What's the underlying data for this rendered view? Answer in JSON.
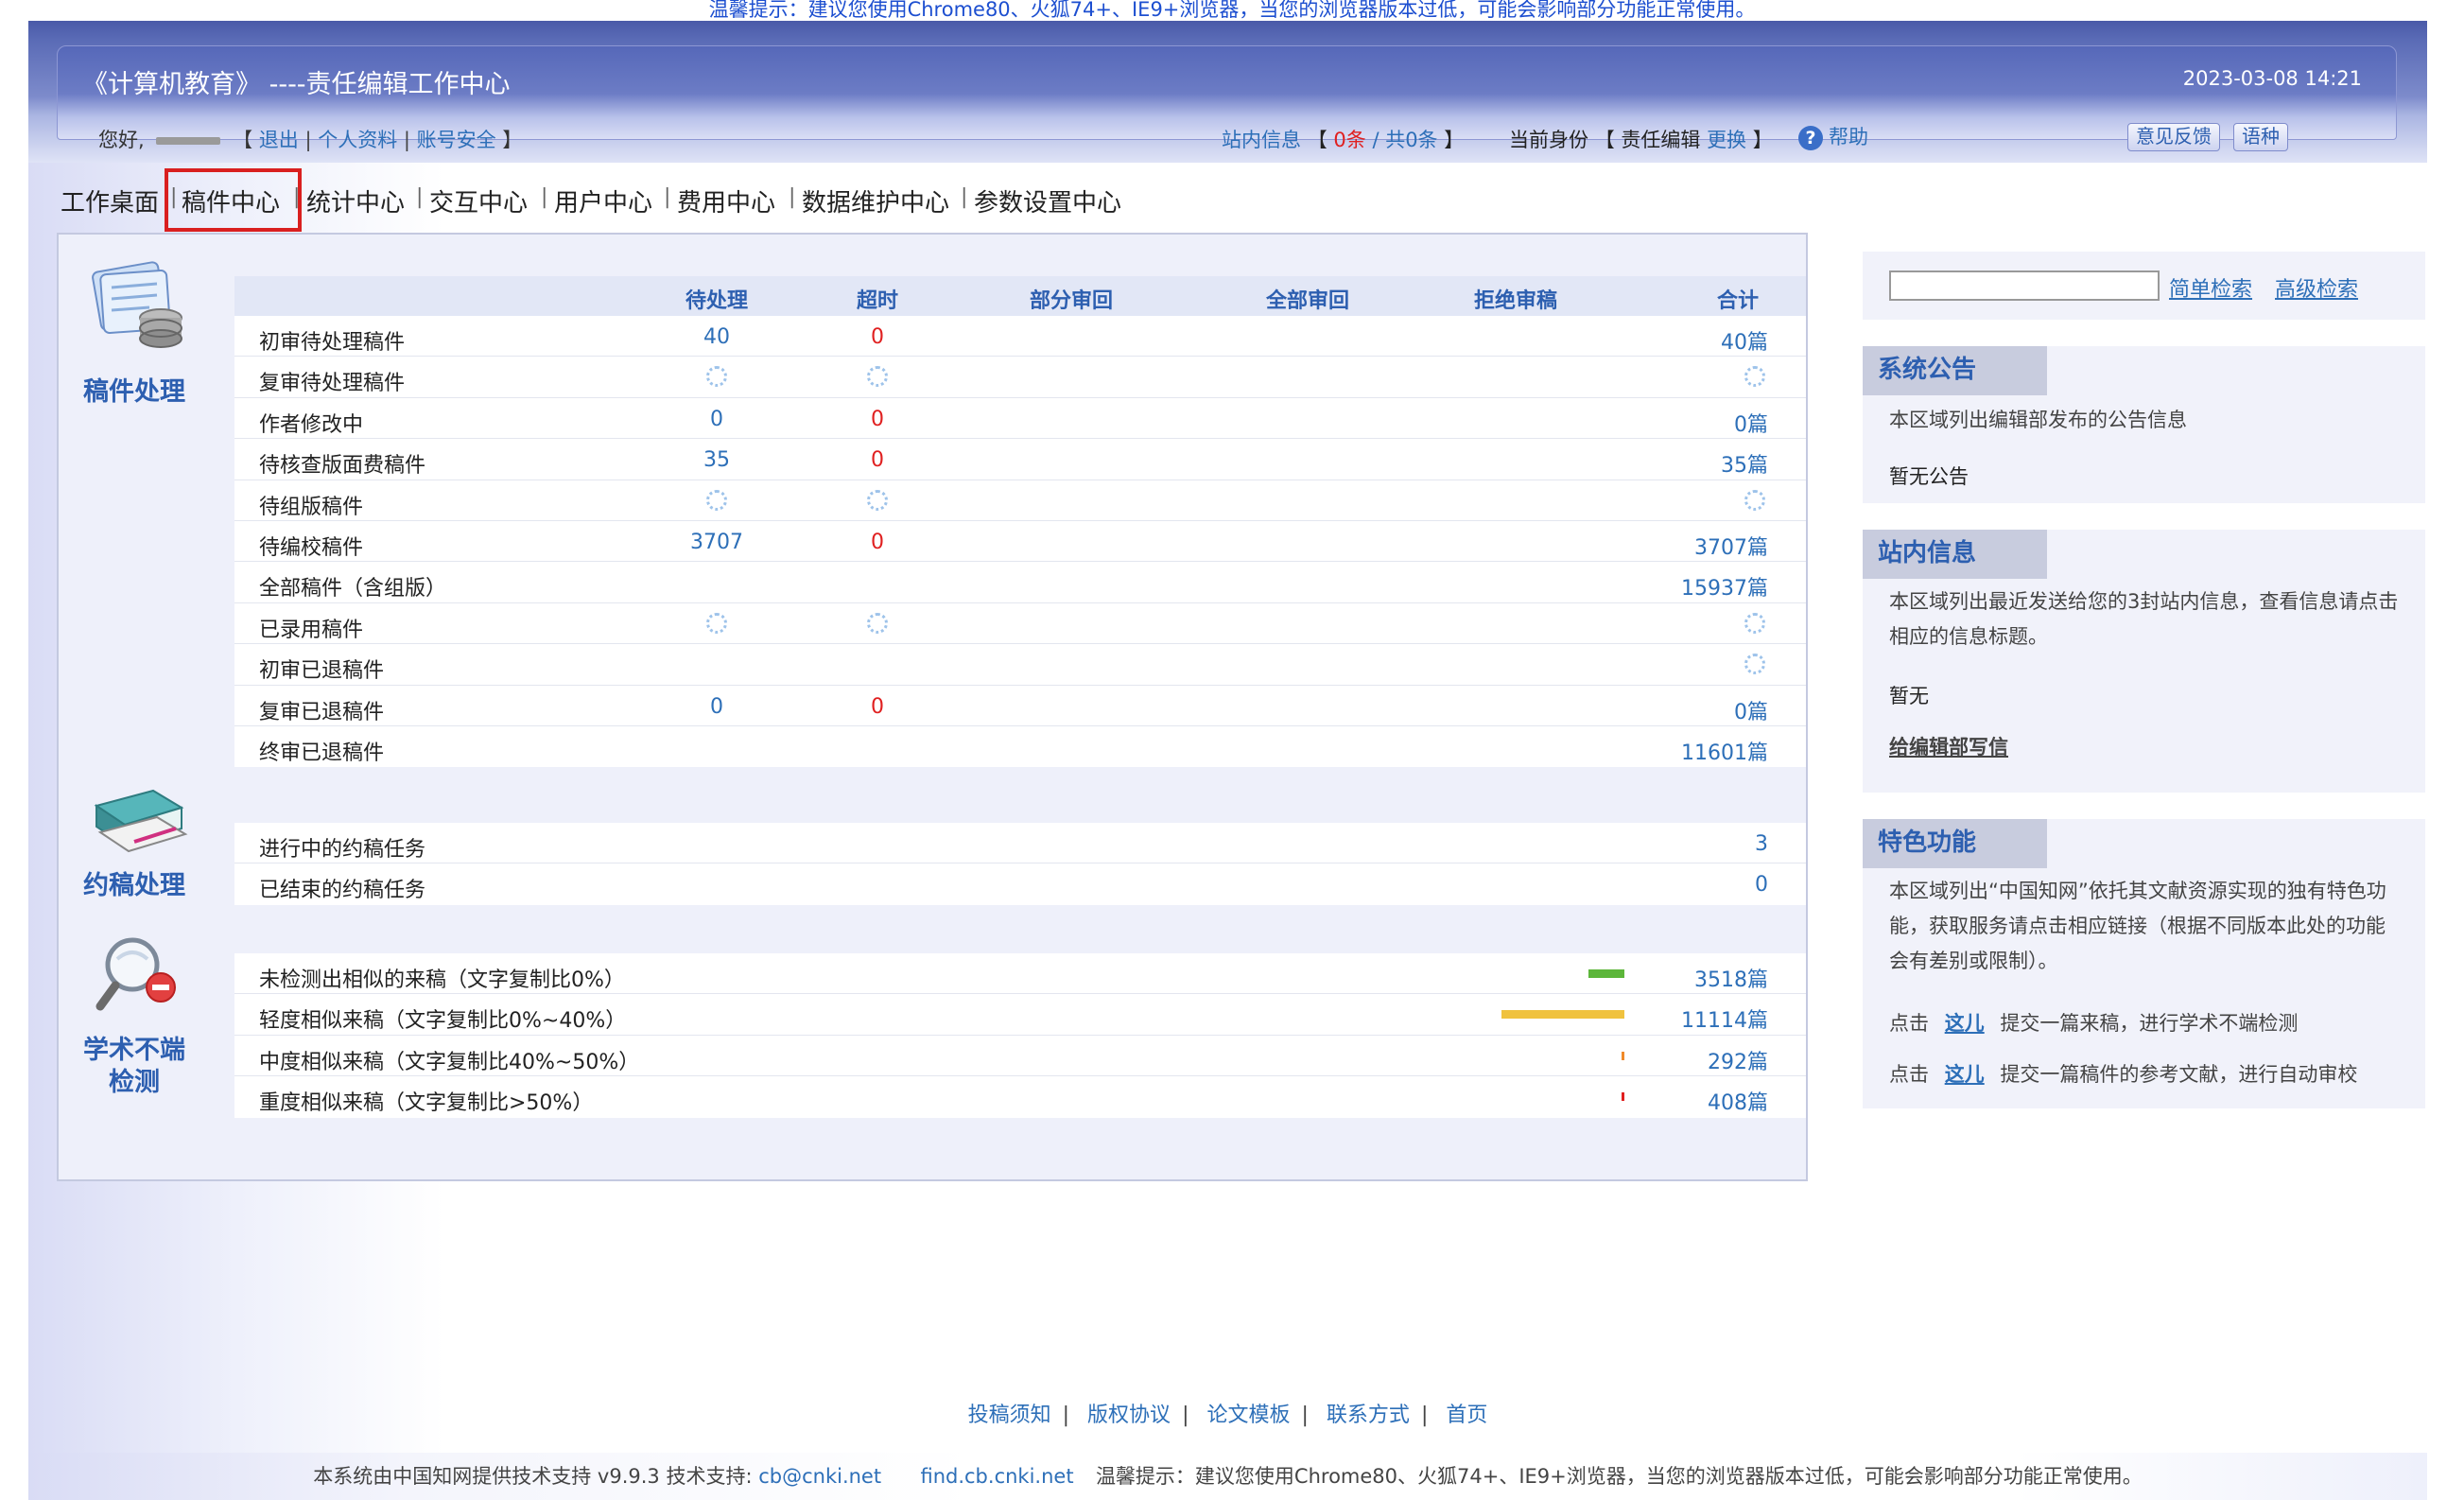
{
  "top_warning": "温馨提示：建议您使用Chrome80、火狐74+、IE9+浏览器，当您的浏览器版本过低，可能会影响部分功能正常使用。",
  "header": {
    "title": "《计算机教育》 ----责任编辑工作中心",
    "datetime": "2023-03-08 14:21",
    "greeting": "您好,",
    "bracket_open": "【",
    "logout": "退出",
    "profile": "个人资料",
    "account_security": "账号安全",
    "bracket_close": "】",
    "site_msg_label": "站内信息",
    "site_msg_count": "0条",
    "site_msg_total": "/ 共0条",
    "identity_label": "当前身份",
    "identity_value": "责任编辑",
    "switch": "更换",
    "help": "帮助",
    "feedback_btn": "意见反馈",
    "lang_btn": "语种"
  },
  "nav": {
    "items": [
      "工作桌面",
      "稿件中心",
      "统计中心",
      "交互中心",
      "用户中心",
      "费用中心",
      "数据维护中心",
      "参数设置中心"
    ],
    "active": "稿件中心"
  },
  "manuscripts": {
    "section_label": "稿件处理",
    "columns": [
      "待处理",
      "超时",
      "部分审回",
      "全部审回",
      "拒绝审稿",
      "合计"
    ],
    "rows": [
      {
        "name": "初审待处理稿件",
        "pending": "40",
        "overdue": "0",
        "total": "40篇"
      },
      {
        "name": "复审待处理稿件",
        "pending": "",
        "overdue": "",
        "total": ""
      },
      {
        "name": "作者修改中",
        "pending": "0",
        "overdue": "0",
        "total": "0篇"
      },
      {
        "name": "待核查版面费稿件",
        "pending": "35",
        "overdue": "0",
        "total": "35篇"
      },
      {
        "name": "待组版稿件",
        "pending": "",
        "overdue": "",
        "total": ""
      },
      {
        "name": "待编校稿件",
        "pending": "3707",
        "overdue": "0",
        "total": "3707篇"
      },
      {
        "name": "全部稿件（含组版）",
        "pending": "",
        "overdue": "",
        "total": "15937篇"
      },
      {
        "name": "已录用稿件",
        "pending": "",
        "overdue": "",
        "total": ""
      },
      {
        "name": "初审已退稿件",
        "pending": "",
        "overdue": "",
        "total": ""
      },
      {
        "name": "复审已退稿件",
        "pending": "0",
        "overdue": "0",
        "total": "0篇"
      },
      {
        "name": "终审已退稿件",
        "pending": "",
        "overdue": "",
        "total": "11601篇"
      }
    ]
  },
  "solicitation": {
    "section_label": "约稿处理",
    "rows": [
      {
        "name": "进行中的约稿任务",
        "total": "3"
      },
      {
        "name": "已结束的约稿任务",
        "total": "0"
      }
    ]
  },
  "misconduct": {
    "section_label_1": "学术不端",
    "section_label_2": "检测",
    "rows": [
      {
        "name": "未检测出相似的来稿（文字复制比0%）",
        "total": "3518篇",
        "count": 3518,
        "color": "#5cb63a"
      },
      {
        "name": "轻度相似来稿（文字复制比0%~40%）",
        "total": "11114篇",
        "count": 11114,
        "color": "#f0c23e"
      },
      {
        "name": "中度相似来稿（文字复制比40%~50%）",
        "total": "292篇",
        "count": 292,
        "color": "#f08a2a"
      },
      {
        "name": "重度相似来稿（文字复制比>50%）",
        "total": "408篇",
        "count": 408,
        "color": "#e02020"
      }
    ]
  },
  "search": {
    "simple": "简单检索",
    "advanced": "高级检索"
  },
  "announcement": {
    "title": "系统公告",
    "desc": "本区域列出编辑部发布的公告信息",
    "content": "暂无公告"
  },
  "site_info": {
    "title": "站内信息",
    "desc": "本区域列出最近发送给您的3封站内信息，查看信息请点击相应的信息标题。",
    "content": "暂无",
    "write_link": "给编辑部写信"
  },
  "features": {
    "title": "特色功能",
    "desc": "本区域列出“中国知网”依托其文献资源实现的独有特色功能，获取服务请点击相应链接（根据不同版本此处的功能会有差别或限制）。",
    "line1_pre": "点击",
    "line1_link": "这儿",
    "line1_post": "提交一篇来稿，进行学术不端检测",
    "line2_pre": "点击",
    "line2_link": "这儿",
    "line2_post": "提交一篇稿件的参考文献，进行自动审校"
  },
  "footer": {
    "links": [
      "投稿须知",
      "版权协议",
      "论文模板",
      "联系方式",
      "首页"
    ],
    "support_text": "本系统由中国知网提供技术支持 v9.9.3 技术支持:",
    "email": "cb@cnki.net",
    "site": "find.cb.cnki.net",
    "warning": "温馨提示：建议您使用Chrome80、火狐74+、IE9+浏览器，当您的浏览器版本过低，可能会影响部分功能正常使用。"
  }
}
